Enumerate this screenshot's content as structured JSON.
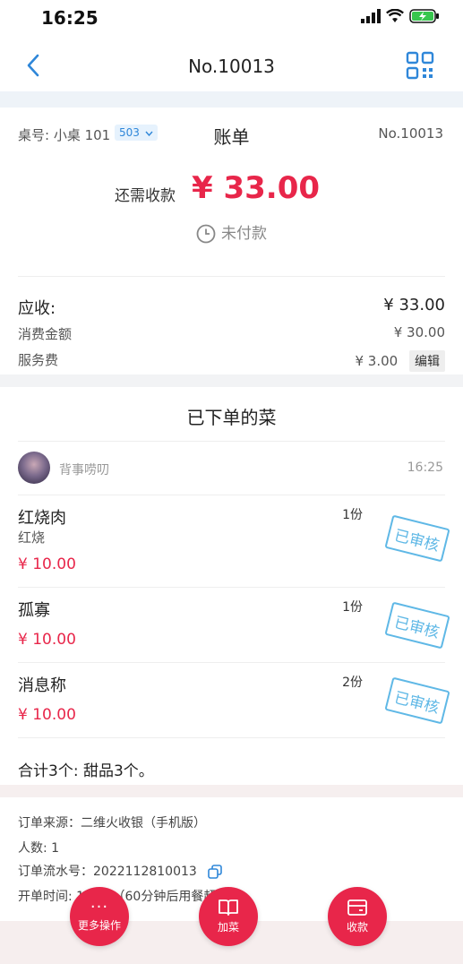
{
  "status_bar": {
    "time": "16:25"
  },
  "nav": {
    "title": "No.10013"
  },
  "bill": {
    "table_label": "桌号: 小桌 101",
    "seat_tag": "503",
    "title": "账单",
    "bill_no": "No.10013",
    "due_label": "还需收款",
    "due_amount": "¥ 33.00",
    "pay_status": "未付款",
    "receivable_label": "应收:",
    "receivable_value": "¥ 33.00",
    "consumption_label": "消费金额",
    "consumption_value": "¥ 30.00",
    "service_label": "服务费",
    "service_value": "¥ 3.00",
    "edit_label": "编辑"
  },
  "orders": {
    "title": "已下单的菜",
    "user_name": "背事唠叨",
    "user_time": "16:25",
    "stamp_text": "已审核",
    "items": [
      {
        "name": "红烧肉",
        "note": "红烧",
        "price": "¥ 10.00",
        "qty": "1份"
      },
      {
        "name": "孤寡",
        "note": "",
        "price": "¥ 10.00",
        "qty": "1份"
      },
      {
        "name": "消息称",
        "note": "",
        "price": "¥ 10.00",
        "qty": "2份"
      }
    ],
    "summary": "合计3个: 甜品3个。"
  },
  "info": {
    "source": "订单来源：二维火收银（手机版）",
    "people": "人数: 1",
    "serial": "订单流水号：2022112810013",
    "open_time": "开单时间: 16:25（60分钟后用餐超时)"
  },
  "actions": {
    "more_dots": "···",
    "more_label": "更多操作",
    "add_label": "加菜",
    "pay_label": "收款"
  },
  "colors": {
    "accent": "#e8264a",
    "link": "#2f87d9",
    "stamp": "#5fb8e6"
  }
}
